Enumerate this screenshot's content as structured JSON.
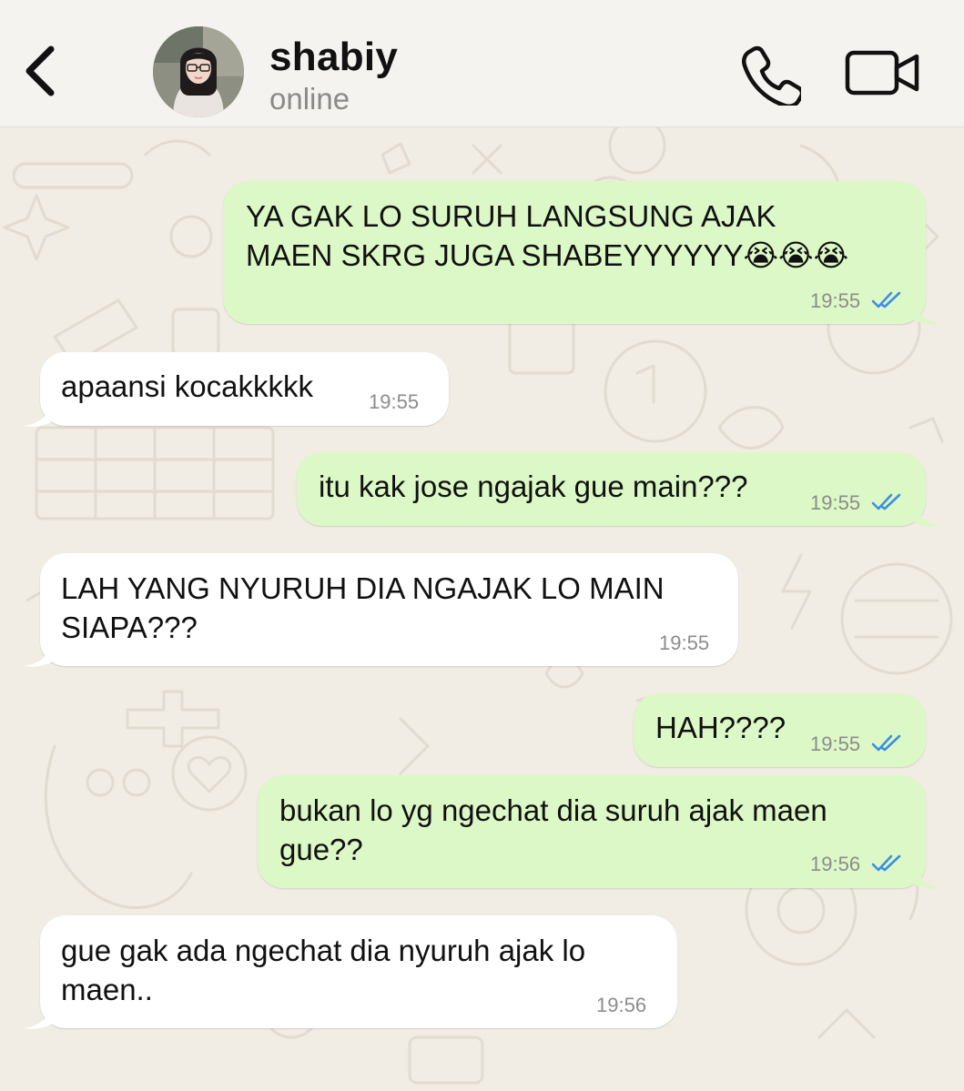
{
  "header": {
    "contact_name": "shabiy",
    "status": "online",
    "icons": {
      "back": "chevron-left-icon",
      "call": "phone-icon",
      "video": "video-camera-icon"
    }
  },
  "colors": {
    "outgoing_bubble": "#dcf8c6",
    "incoming_bubble": "#ffffff",
    "read_ticks": "#3d8fe0",
    "wallpaper": "#f1ece4"
  },
  "messages": [
    {
      "direction": "out",
      "lines": [
        "YA GAK LO SURUH LANGSUNG AJAK",
        "MAEN SKRG JUGA SHABEYYYYYY😭😭😭"
      ],
      "time": "19:55",
      "status": "read"
    },
    {
      "direction": "in",
      "lines": [
        "apaansi kocakkkkk"
      ],
      "time": "19:55"
    },
    {
      "direction": "out",
      "lines": [
        "itu kak jose ngajak gue main???"
      ],
      "time": "19:55",
      "status": "read"
    },
    {
      "direction": "in",
      "lines": [
        "LAH YANG NYURUH DIA NGAJAK LO MAIN",
        "SIAPA???"
      ],
      "time": "19:55"
    },
    {
      "direction": "out",
      "lines": [
        "HAH????"
      ],
      "time": "19:55",
      "status": "read"
    },
    {
      "direction": "out",
      "lines": [
        "bukan lo yg ngechat dia suruh ajak maen",
        "gue??"
      ],
      "time": "19:56",
      "status": "read"
    },
    {
      "direction": "in",
      "lines": [
        "gue gak ada ngechat dia nyuruh ajak lo",
        "maen.."
      ],
      "time": "19:56"
    }
  ]
}
